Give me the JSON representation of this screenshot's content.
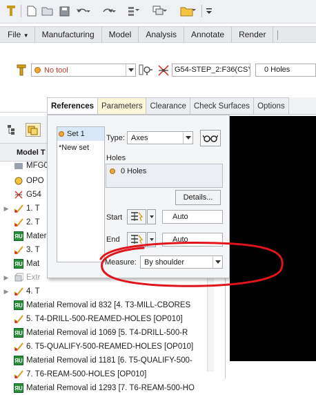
{
  "quick_access": {
    "icons": [
      "app-logo-icon",
      "new-icon",
      "open-icon",
      "save-icon",
      "undo-icon",
      "redo-icon",
      "regenerate-icon",
      "windows-icon",
      "open-folder-icon",
      "customize-icon"
    ]
  },
  "ribbon": {
    "file_label": "File",
    "tabs": [
      "Manufacturing",
      "Model",
      "Analysis",
      "Annotate",
      "Render"
    ]
  },
  "toolpath_bar": {
    "tool_value": "No tool",
    "csys_value": "G54-STEP_2:F36(CSY",
    "holes_value": "0 Holes"
  },
  "dashboard_tabs": [
    {
      "label": "References",
      "active": true
    },
    {
      "label": "Parameters",
      "active": false
    },
    {
      "label": "Clearance",
      "active": false
    },
    {
      "label": "Check Surfaces",
      "active": false
    },
    {
      "label": "Options",
      "active": false
    }
  ],
  "references": {
    "sets": [
      {
        "label": "Set 1",
        "selected": true
      },
      {
        "label": "*New set",
        "selected": false
      }
    ],
    "type_label": "Type:",
    "type_value": "Axes",
    "holes_label": "Holes",
    "holes_item": "0 Holes",
    "details_button": "Details...",
    "start_label": "Start",
    "start_value": "Auto",
    "end_label": "End",
    "end_value": "Auto",
    "measure_label": "Measure:",
    "measure_value": "By shoulder"
  },
  "model_tree": {
    "header": "Model T",
    "rows": [
      {
        "label": "MFG0",
        "icon": "folder-icon",
        "expander": false,
        "grey": false
      },
      {
        "label": "OPO",
        "icon": "operation-icon",
        "expander": false,
        "grey": false
      },
      {
        "label": "G54",
        "icon": "csys-icon",
        "expander": false,
        "grey": false
      },
      {
        "label": "1. T",
        "icon": "drill-sequence-icon",
        "expander": true,
        "grey": false
      },
      {
        "label": "2. T",
        "icon": "drill-sequence-icon",
        "expander": false,
        "grey": false
      },
      {
        "label": "Materi",
        "icon": "material-removal-icon",
        "expander": false,
        "grey": false
      },
      {
        "label": "3. T",
        "icon": "drill-sequence-icon",
        "expander": false,
        "grey": false
      },
      {
        "label": "Mat",
        "icon": "material-removal-icon",
        "expander": false,
        "grey": false
      },
      {
        "label": "Extr",
        "icon": "extrude-icon",
        "expander": true,
        "grey": true
      },
      {
        "label": "4. T",
        "icon": "drill-sequence-icon",
        "expander": true,
        "grey": false
      },
      {
        "label": "Material Removal id 832 [4. T3-MILL-CBORES",
        "icon": "material-removal-icon",
        "expander": false,
        "grey": false
      },
      {
        "label": "5. T4-DRILL-500-REAMED-HOLES [OP010]",
        "icon": "drill-sequence-icon",
        "expander": false,
        "grey": false
      },
      {
        "label": "Material Removal id 1069 [5. T4-DRILL-500-R",
        "icon": "material-removal-icon",
        "expander": false,
        "grey": false
      },
      {
        "label": "6. T5-QUALIFY-500-REAMED-HOLES [OP010]",
        "icon": "drill-sequence-icon",
        "expander": false,
        "grey": false
      },
      {
        "label": "Material Removal id 1181 [6. T5-QUALIFY-500-",
        "icon": "material-removal-icon",
        "expander": false,
        "grey": false
      },
      {
        "label": "7. T6-REAM-500-HOLES [OP010]",
        "icon": "drill-sequence-icon",
        "expander": false,
        "grey": false
      },
      {
        "label": "Material Removal id 1293 [7. T6-REAM-500-HO",
        "icon": "material-removal-icon",
        "expander": false,
        "grey": false
      }
    ]
  },
  "colors": {
    "annotation": "#e0141b",
    "graphics_bg": "#000000",
    "parameters_tab_bg": "#fdf6d9"
  }
}
